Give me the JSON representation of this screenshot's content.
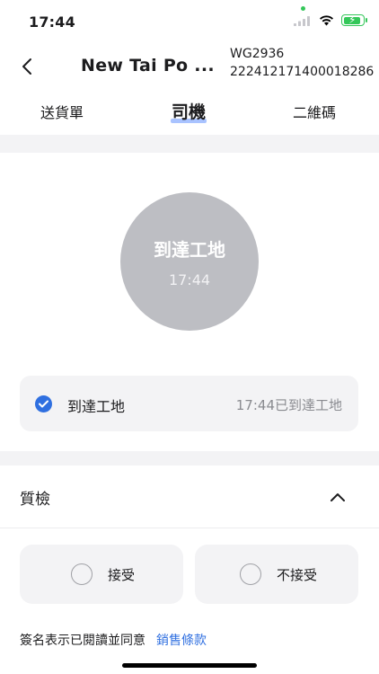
{
  "status_bar": {
    "time": "17:44"
  },
  "header": {
    "title": "New Tai Po ...",
    "code": "WG2936",
    "order_number": "222412171400018286"
  },
  "tabs": [
    {
      "label": "送貨單",
      "active": false
    },
    {
      "label": "司機",
      "active": true
    },
    {
      "label": "二維碼",
      "active": false
    }
  ],
  "circle": {
    "title": "到達工地",
    "time": "17:44"
  },
  "status_item": {
    "label": "到達工地",
    "detail": "17:44已到達工地"
  },
  "quality_check": {
    "title": "質檢",
    "options": [
      {
        "label": "接受",
        "selected": false
      },
      {
        "label": "不接受",
        "selected": false
      }
    ]
  },
  "terms": {
    "text": "簽名表示已閱讀並同意",
    "link": "銷售條款"
  },
  "colors": {
    "accent": "#2f6fe0",
    "circle": "#bdbec3",
    "tab_indicator": "#a9c3ff",
    "battery": "#34c759"
  }
}
